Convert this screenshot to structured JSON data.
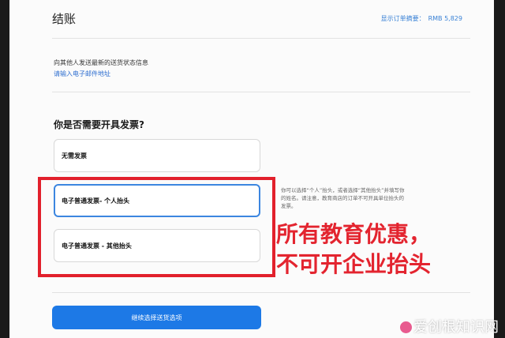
{
  "header": {
    "title": "结账",
    "summary_label": "显示订单摘要：",
    "summary_amount": "RMB 5,829"
  },
  "notify": {
    "text": "向其他人发送最新的送货状态信息",
    "link": "请输入电子邮件地址"
  },
  "invoice": {
    "question": "你是否需要开具发票?",
    "options": [
      {
        "label": "无需发票",
        "selected": false
      },
      {
        "label": "电子普通发票- 个人抬头",
        "selected": true
      },
      {
        "label": "电子普通发票 - 其他抬头",
        "selected": false
      }
    ],
    "info": "你可以选择“个人”抬头，或者选择“其他抬头”并填写你的姓名。请注意，教育商店的订单不可开具单位抬头的发票。"
  },
  "annotation": {
    "line1": "所有教育优惠，",
    "line2": "不可开企业抬头",
    "color": "#e3242f"
  },
  "actions": {
    "continue_label": "继续选择送货选项"
  },
  "watermark": {
    "text": "爱创根知识网"
  },
  "colors": {
    "accent": "#1d79e6",
    "link": "#2f6fd0",
    "selected_border": "#3c86e0"
  }
}
